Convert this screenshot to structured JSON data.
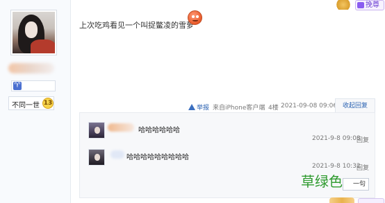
{
  "author": {
    "title_label": "不同一世",
    "level": "13",
    "zodiac_symbol": "♈"
  },
  "header": {
    "upgrade_label": "挽尊"
  },
  "post": {
    "text": "上次吃鸡看见一个叫捉鳖凌的雪萝",
    "emoji_icon": "angry-face-icon"
  },
  "meta": {
    "report_label": "举报",
    "source": "来自iPhone客户端",
    "floor": "4楼",
    "datetime": "2021-09-08 09:06",
    "collapse_reply_label": "收起回复"
  },
  "replies": [
    {
      "text": "哈哈哈哈哈哈",
      "time": "2021-9-8 09:08",
      "reply_label": "回复"
    },
    {
      "text": "哈哈哈哈哈哈哈哈哈",
      "time": "2021-9-8 10:32",
      "reply_label": "回复"
    }
  ],
  "say_button_label": "一句",
  "watermark": "草绿色",
  "colors": {
    "link": "#2d64b3",
    "panel_bg": "#f7f8fa",
    "watermark": "#2f9b2f",
    "badge": "#f6d34a"
  }
}
